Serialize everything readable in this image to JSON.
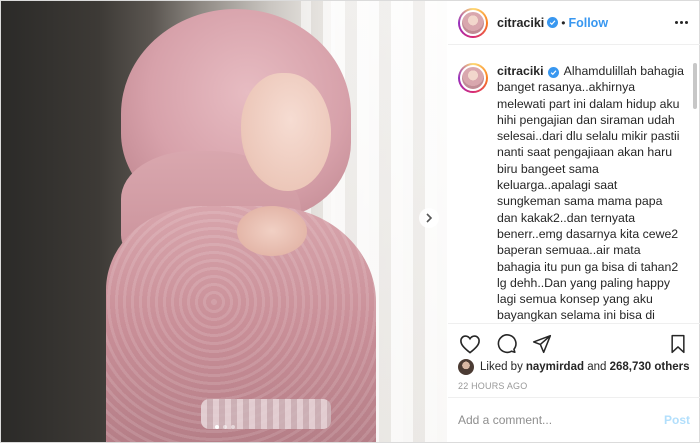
{
  "post": {
    "username": "citraciki",
    "follow_label": "Follow",
    "separator": "•",
    "caption": "Alhamdulillah bahagia banget rasanya..akhirnya melewati part ini dalam hidup aku hihi pengajian dan siraman udah selesai..dari dlu selalu mikir pastii nanti saat pengajiaan akan haru biru bangeet sama keluarga..apalagi saat sungkeman sama mama papa dan kakak2..dan ternyata benerr..emg dasarnya kita cewe2 baperan semuaa..air mata bahagia itu pun ga bisa di tahan2 lg dehh..Dan yang paling happy lagi semua konsep yang aku bayangkan selama ini bisa di wujudkan jadi nyata..full of flowers!! 🌸 saat pertama kali liat decor di venue aku merinding sendiri..😭Allah baik banget sama aku.. apa yang dibayangkan alhamdulillah bisa di wujudkan..aku minta doa nya yaaa",
    "likes_prefix": "Liked by ",
    "liked_by_user": "naymirdad",
    "likes_middle": " and ",
    "likes_count": "268,730 others",
    "timestamp": "22 HOURS AGO",
    "comment_placeholder": "Add a comment...",
    "post_button": "Post",
    "carousel": {
      "total_slides": 3,
      "active_slide": 1
    }
  },
  "icons": {
    "verified": "verified-badge-icon",
    "more": "more-options-icon",
    "like": "heart-icon",
    "comment": "comment-icon",
    "share": "share-icon",
    "save": "bookmark-icon",
    "next": "chevron-right-icon"
  },
  "colors": {
    "accent": "#3897f0",
    "post_disabled": "#b2dffc",
    "text": "#262626",
    "muted": "#8e8e8e"
  }
}
